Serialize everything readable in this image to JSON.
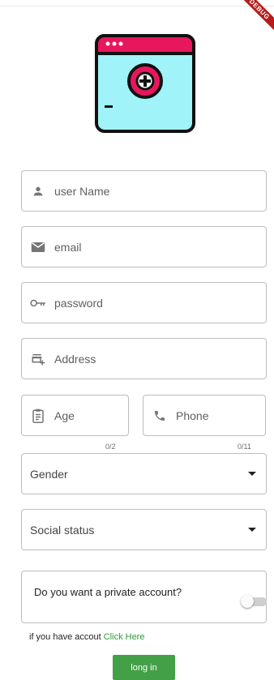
{
  "debug_banner": "DEBUG",
  "form": {
    "username_label": "user Name",
    "email_label": "email",
    "password_label": "password",
    "address_label": "Address",
    "age_label": "Age",
    "age_counter": "0/2",
    "phone_label": "Phone",
    "phone_counter": "0/11"
  },
  "selects": {
    "gender": "Gender",
    "social_status": "Social status"
  },
  "private_account": {
    "question": "Do you want a private account?",
    "enabled": false
  },
  "account_prompt": {
    "text": "if you have  accout",
    "link": "Click Here"
  },
  "login_button": "long in",
  "colors": {
    "accent_green": "#43a047",
    "link_green": "#2e9a3d",
    "logo_header": "#e8175d",
    "logo_body": "#9ff3f9"
  }
}
